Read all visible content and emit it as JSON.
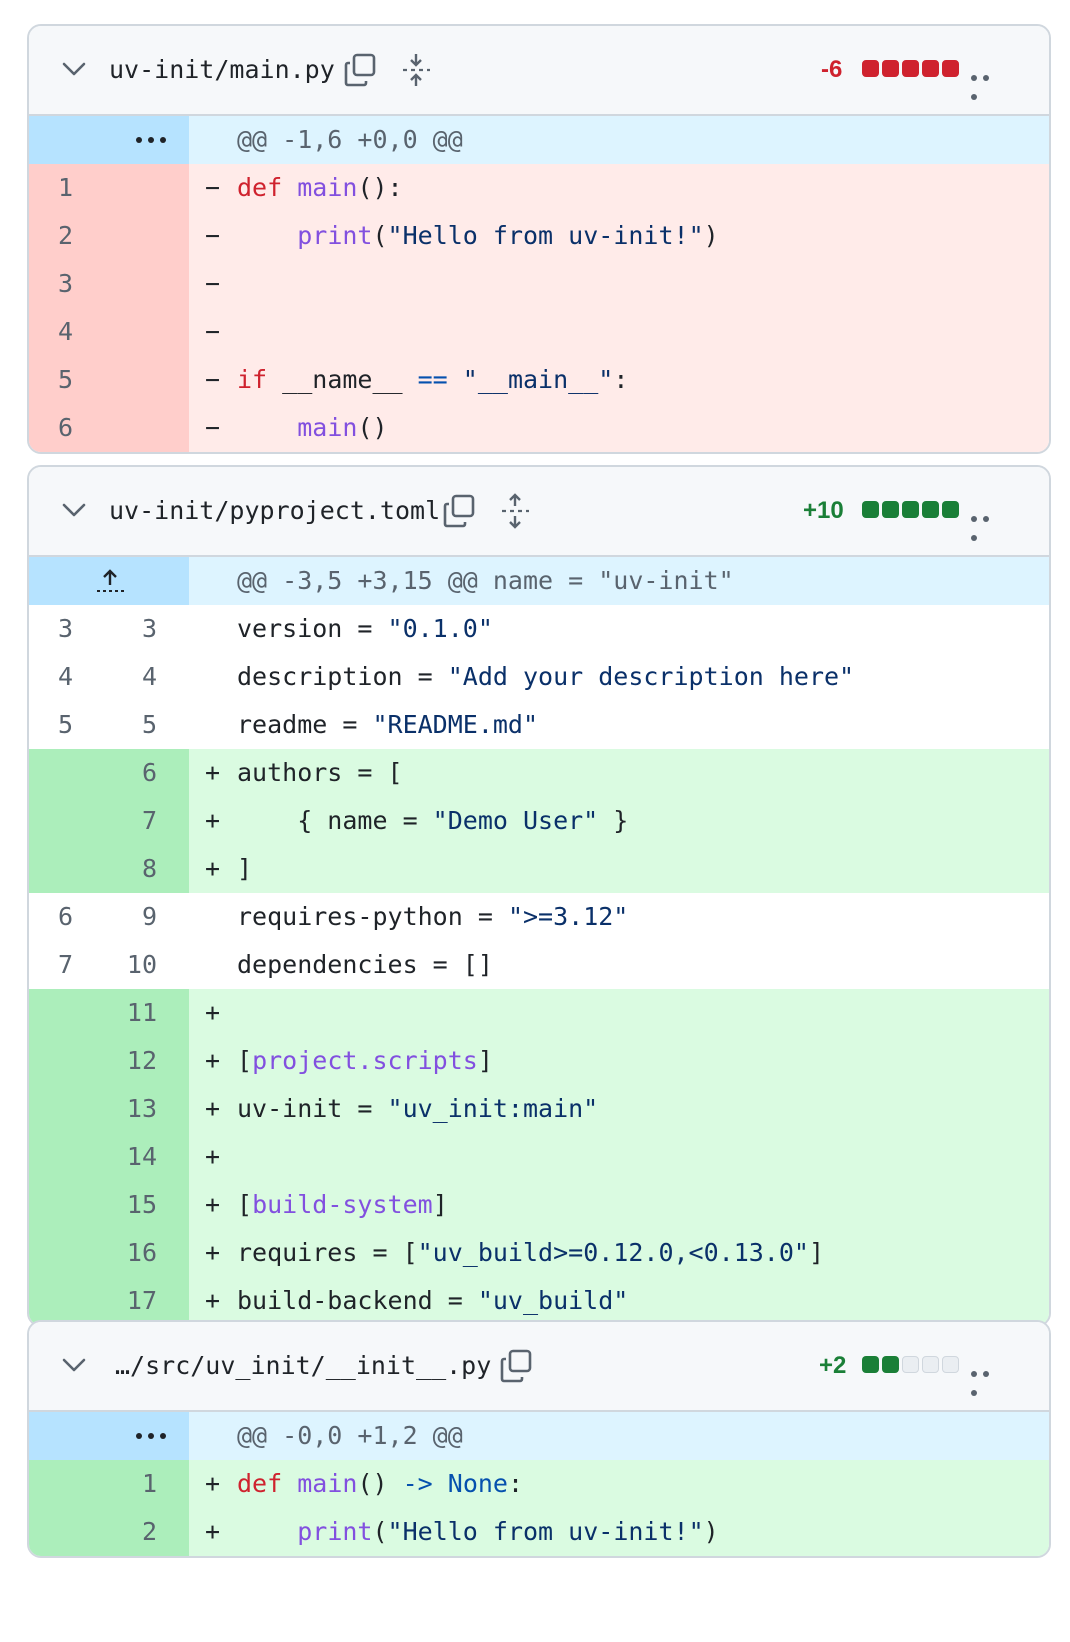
{
  "files": [
    {
      "name": "uv-init/main.py",
      "stat": "-6",
      "stat_color": "#cf222e",
      "hunk_header": "@@ -1,6 +0,0 @@",
      "lines": [
        {
          "old": "1",
          "new": "",
          "sign": "−",
          "tokens": [
            [
              "kw",
              "def"
            ],
            [
              "pl",
              " "
            ],
            [
              "fn",
              "main"
            ],
            [
              "pl",
              "():"
            ]
          ]
        },
        {
          "old": "2",
          "new": "",
          "sign": "−",
          "tokens": [
            [
              "pl",
              "    "
            ],
            [
              "fn",
              "print"
            ],
            [
              "pl",
              "("
            ],
            [
              "str",
              "\"Hello from uv-init!\""
            ],
            [
              "pl",
              ")"
            ]
          ]
        },
        {
          "old": "3",
          "new": "",
          "sign": "−",
          "tokens": []
        },
        {
          "old": "4",
          "new": "",
          "sign": "−",
          "tokens": []
        },
        {
          "old": "5",
          "new": "",
          "sign": "−",
          "tokens": [
            [
              "kw",
              "if"
            ],
            [
              "pl",
              " __name__ "
            ],
            [
              "op",
              "=="
            ],
            [
              "pl",
              " "
            ],
            [
              "str",
              "\"__main__\""
            ],
            [
              "pl",
              ":"
            ]
          ]
        },
        {
          "old": "6",
          "new": "",
          "sign": "−",
          "tokens": [
            [
              "pl",
              "    "
            ],
            [
              "fn",
              "main"
            ],
            [
              "pl",
              "()"
            ]
          ]
        }
      ]
    },
    {
      "name": "uv-init/pyproject.toml",
      "stat": "+10",
      "stat_color": "#1a7f37",
      "hunk_header": "@@ -3,5 +3,15 @@ name = \"uv-init\"",
      "lines": [
        {
          "old": "3",
          "new": "3",
          "sign": "",
          "tokens": [
            [
              "pl",
              "version = "
            ],
            [
              "str",
              "\"0.1.0\""
            ]
          ]
        },
        {
          "old": "4",
          "new": "4",
          "sign": "",
          "tokens": [
            [
              "pl",
              "description = "
            ],
            [
              "str",
              "\"Add your description here\""
            ]
          ]
        },
        {
          "old": "5",
          "new": "5",
          "sign": "",
          "tokens": [
            [
              "pl",
              "readme = "
            ],
            [
              "str",
              "\"README.md\""
            ]
          ]
        },
        {
          "old": "",
          "new": "6",
          "sign": "+",
          "tokens": [
            [
              "pl",
              "authors = ["
            ]
          ]
        },
        {
          "old": "",
          "new": "7",
          "sign": "+",
          "tokens": [
            [
              "pl",
              "    { name = "
            ],
            [
              "str",
              "\"Demo User\""
            ],
            [
              "pl",
              " }"
            ]
          ]
        },
        {
          "old": "",
          "new": "8",
          "sign": "+",
          "tokens": [
            [
              "pl",
              "]"
            ]
          ]
        },
        {
          "old": "6",
          "new": "9",
          "sign": "",
          "tokens": [
            [
              "pl",
              "requires-python = "
            ],
            [
              "str",
              "\">=3.12\""
            ]
          ]
        },
        {
          "old": "7",
          "new": "10",
          "sign": "",
          "tokens": [
            [
              "pl",
              "dependencies = []"
            ]
          ]
        },
        {
          "old": "",
          "new": "11",
          "sign": "+",
          "tokens": []
        },
        {
          "old": "",
          "new": "12",
          "sign": "+",
          "tokens": [
            [
              "pl",
              "["
            ],
            [
              "fn",
              "project.scripts"
            ],
            [
              "pl",
              "]"
            ]
          ]
        },
        {
          "old": "",
          "new": "13",
          "sign": "+",
          "tokens": [
            [
              "pl",
              "uv-init = "
            ],
            [
              "str",
              "\"uv_init:main\""
            ]
          ]
        },
        {
          "old": "",
          "new": "14",
          "sign": "+",
          "tokens": []
        },
        {
          "old": "",
          "new": "15",
          "sign": "+",
          "tokens": [
            [
              "pl",
              "["
            ],
            [
              "fn",
              "build-system"
            ],
            [
              "pl",
              "]"
            ]
          ]
        },
        {
          "old": "",
          "new": "16",
          "sign": "+",
          "tokens": [
            [
              "pl",
              "requires = ["
            ],
            [
              "str",
              "\"uv_build>=0.12.0,<0.13.0\""
            ],
            [
              "pl",
              "]"
            ]
          ]
        },
        {
          "old": "",
          "new": "17",
          "sign": "+",
          "tokens": [
            [
              "pl",
              "build-backend = "
            ],
            [
              "str",
              "\"uv_build\""
            ]
          ]
        }
      ]
    },
    {
      "name": "…/src/uv_init/__init__.py",
      "stat": "+2",
      "stat_color": "#1a7f37",
      "hunk_header": "@@ -0,0 +1,2 @@",
      "lines": [
        {
          "old": "",
          "new": "1",
          "sign": "+",
          "tokens": [
            [
              "kw",
              "def"
            ],
            [
              "pl",
              " "
            ],
            [
              "fn",
              "main"
            ],
            [
              "pl",
              "() "
            ],
            [
              "op",
              "->"
            ],
            [
              "pl",
              " "
            ],
            [
              "op",
              "None"
            ],
            [
              "pl",
              ":"
            ]
          ]
        },
        {
          "old": "",
          "new": "2",
          "sign": "+",
          "tokens": [
            [
              "pl",
              "    "
            ],
            [
              "fn",
              "print"
            ],
            [
              "pl",
              "("
            ],
            [
              "str",
              "\"Hello from uv-init!\""
            ],
            [
              "pl",
              ")"
            ]
          ]
        }
      ]
    }
  ]
}
